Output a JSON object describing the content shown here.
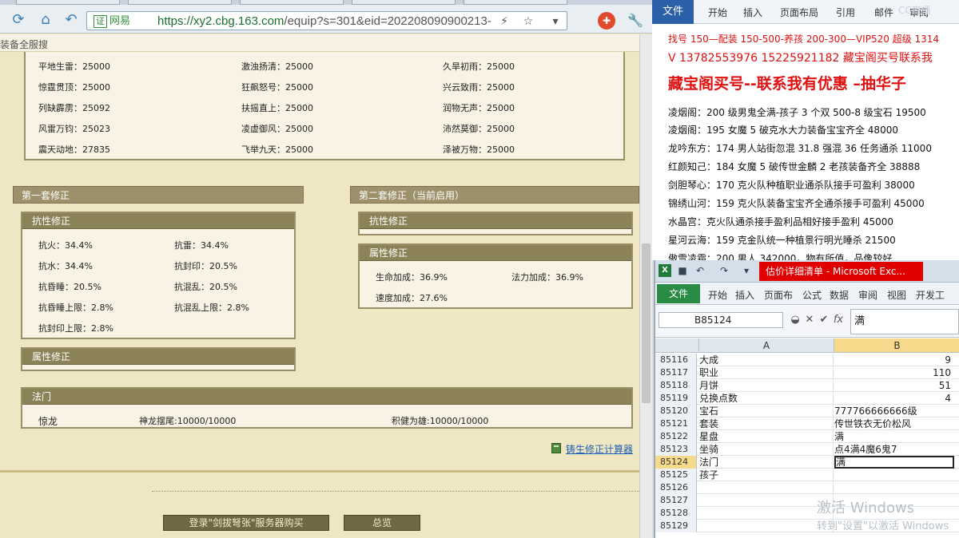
{
  "browser": {
    "address": {
      "cert_badge": "证",
      "cert_label": "网易",
      "url_host": "https://xy2.cbg.163.com",
      "url_rest": "/equip?s=301&eid=202208090900213-"
    },
    "subbar_text": "装备全服搜",
    "colors": {
      "accent": "#8c8258",
      "page_bg": "#efe6c4",
      "link": "#1d5fb3"
    }
  },
  "skills": [
    [
      {
        "t": "平地生雷：25000"
      },
      {
        "t": "激浊扬清：25000"
      },
      {
        "t": "久旱初雨：25000"
      }
    ],
    [
      {
        "t": "惊霆贯顶：25000"
      },
      {
        "t": "狂飙怒号：25000"
      },
      {
        "t": "兴云致雨：25000"
      }
    ],
    [
      {
        "t": "列缺霹雳：25092"
      },
      {
        "t": "扶摇直上：25000"
      },
      {
        "t": "润物无声：25000"
      }
    ],
    [
      {
        "t": "风雷万钧：25023"
      },
      {
        "t": "凌虚御风：25000"
      },
      {
        "t": "沛然莫御：25000"
      }
    ],
    [
      {
        "t": "震天动地：27835"
      },
      {
        "t": "飞举九天：25000"
      },
      {
        "t": "泽被万物：25000"
      }
    ]
  ],
  "set1": {
    "title": "第一套修正",
    "resist_title": "抗性修正",
    "resist": [
      [
        "抗火：34.4%",
        "抗雷：34.4%"
      ],
      [
        "抗水：34.4%",
        "抗封印：20.5%"
      ],
      [
        "抗昏睡：20.5%",
        "抗混乱：20.5%"
      ],
      [
        "抗昏睡上限：2.8%",
        "抗混乱上限：2.8%"
      ],
      [
        "抗封印上限：2.8%",
        ""
      ]
    ],
    "attr_title": "属性修正"
  },
  "set2": {
    "title": "第二套修正（当前启用）",
    "resist_title": "抗性修正",
    "attr_title": "属性修正",
    "attr": [
      [
        "生命加成：36.9%",
        "法力加成：36.9%"
      ],
      [
        "速度加成：27.6%",
        ""
      ]
    ]
  },
  "fa_men": {
    "title": "法门",
    "name": "惊龙",
    "item1": "神龙摆尾:10000/10000",
    "item2": "积健为雄:10000/10000"
  },
  "calculator_link": "铸生修正计算器",
  "bottom_buttons": [
    "登录\"剑拔弩张\"服务器购买",
    "总览"
  ],
  "word": {
    "tabs": [
      "文件",
      "开始",
      "插入",
      "页面布局",
      "引用",
      "邮件",
      "审阅"
    ],
    "lines": [
      {
        "text": "找号 150—配装 150-500-养孩 200-300—VIP520 超级 1314",
        "style": "red small"
      },
      {
        "text": "V 13782553976    15225921182   藏宝阁买号联系我",
        "style": "red mid"
      },
      {
        "text": "藏宝阁买号--联系我有优惠 –抽华子",
        "style": "red big"
      },
      {
        "text": "凌烟阁：200 级男鬼全满-孩子 3 个双 500-8 级宝石 19500",
        "style": "black"
      },
      {
        "text": "凌烟阁：195 女魔 5 破克水大力装备宝宝齐全 48000",
        "style": "black"
      },
      {
        "text": "龙吟东方：174 男人站街忽混 31.8 强混 36 任务通杀 11000",
        "style": "black"
      },
      {
        "text": "红颜知己：184 女魔 5 破传世金麟 2 老孩装备齐全 38888",
        "style": "black"
      },
      {
        "text": "剑胆琴心：170 克火队种植职业通杀队接手可盈利 38000",
        "style": "black"
      },
      {
        "text": "锦绣山河：159 克火队装备宝宝齐全通杀接手可盈利 45000",
        "style": "black"
      },
      {
        "text": "水晶宫：克火队通杀接手盈利品相好接手盈利 45000",
        "style": "black"
      },
      {
        "text": "星河云海：159 克金队统一种植景行明光睡杀 21500",
        "style": "black"
      },
      {
        "text": "傲雪凌霜：200 男人 342000，物有所值，品像较好",
        "style": "black"
      }
    ],
    "logo_text": "CC直播"
  },
  "excel": {
    "title": "估价详细清单 - Microsoft Exc...",
    "tabs": [
      "文件",
      "开始",
      "插入",
      "页面布",
      "公式",
      "数据",
      "审阅",
      "视图",
      "开发工"
    ],
    "namebox": "B85124",
    "formula_value": "满",
    "columns": [
      "A",
      "B"
    ],
    "rows": [
      {
        "n": "85116",
        "a": "大成",
        "b": "9",
        "num": true
      },
      {
        "n": "85117",
        "a": "职业",
        "b": "110",
        "num": true
      },
      {
        "n": "85118",
        "a": "月饼",
        "b": "51",
        "num": true
      },
      {
        "n": "85119",
        "a": "兑换点数",
        "b": "4",
        "num": true
      },
      {
        "n": "85120",
        "a": "宝石",
        "b": "777766666666级"
      },
      {
        "n": "85121",
        "a": "套装",
        "b": "传世铁衣无价松风"
      },
      {
        "n": "85122",
        "a": "星盘",
        "b": "满"
      },
      {
        "n": "85123",
        "a": "坐骑",
        "b": "点4满4魔6鬼7"
      },
      {
        "n": "85124",
        "a": "法门",
        "b": "满",
        "selected": true
      },
      {
        "n": "85125",
        "a": "孩子",
        "b": ""
      },
      {
        "n": "85126",
        "a": "",
        "b": ""
      },
      {
        "n": "85127",
        "a": "",
        "b": ""
      },
      {
        "n": "85128",
        "a": "",
        "b": ""
      },
      {
        "n": "85129",
        "a": "",
        "b": ""
      }
    ],
    "watermark_line1": "激活 Windows",
    "watermark_line2": "转到\"设置\"以激活 Windows"
  }
}
